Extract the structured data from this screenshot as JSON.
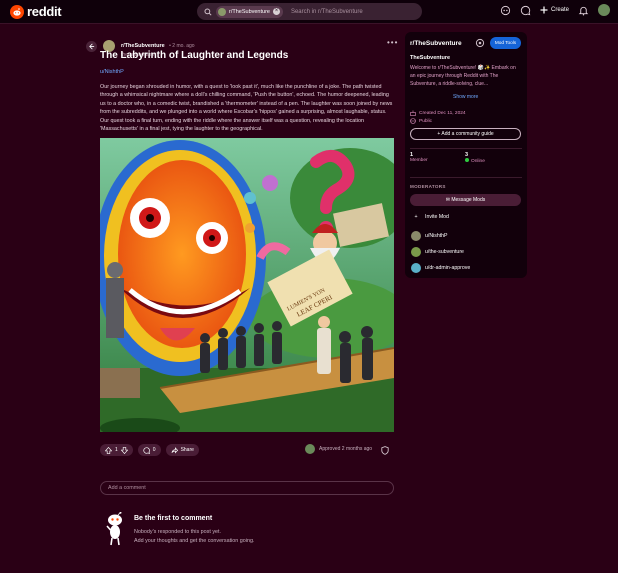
{
  "header": {
    "logo_text": "reddit",
    "search_chip": "r/TheSubventure",
    "search_placeholder": "Search in r/TheSubventure",
    "create_label": "Create"
  },
  "post": {
    "subreddit": "r/TheSubventure",
    "time": "• 2 mo. ago",
    "author": "the-subventure",
    "title": "The Labyrinth of Laughter and Legends",
    "link": "u/NishthP",
    "body": "Our journey began shrouded in humor, with a quest to 'look past it', much like the punchline of a joke. The path twisted through a whimsical nightmare where a doll's chilling command, 'Push the button', echoed. The humor deepened, leading us to a doctor who, in a comedic twist, brandished a 'thermometer' instead of a pen. The laughter was soon joined by news from the subreddits, and we plunged into a world where Escobar's 'hippos' gained a surprising, almost laughable, status. Our quest took a final turn, ending with the riddle where the answer itself was a question, revealing the location 'Massachusetts' in a final jest, tying the laughter to the geographical.",
    "image_sign_text": [
      "LUMIEN'S YON",
      "LEAF CPERI"
    ],
    "votes": "1",
    "comments": "0",
    "share_label": "Share",
    "approved_text": "Approved 2 months ago"
  },
  "comments": {
    "placeholder": "Add a comment",
    "empty_title": "Be the first to comment",
    "empty_line1": "Nobody's responded to this post yet.",
    "empty_line2": "Add your thoughts and get the conversation going."
  },
  "sidebar": {
    "name": "r/TheSubventure",
    "mod_tools_label": "Mod Tools",
    "title": "TheSubventure",
    "description": "Welcome to r/TheSubventure! 🎲✨ Embark on an epic journey through Reddit with The Subventure, a riddle-solving, clue...",
    "show_more": "Show more",
    "created": "Created Dec 11, 2024",
    "visibility": "Public",
    "guide_button": "Add a community guide",
    "members_count": "1",
    "members_label": "Member",
    "online_count": "3",
    "online_label": "Online",
    "moderators_heading": "MODERATORS",
    "message_mods": "Message Mods",
    "invite_mod": "Invite Mod",
    "moderators": [
      {
        "name": "u/NishthP",
        "color": "#8a8a6a"
      },
      {
        "name": "u/the-subventure",
        "color": "#7a9a4a"
      },
      {
        "name": "u/dr-admin-approve",
        "color": "#5ab0c8"
      }
    ]
  },
  "colors": {
    "background": "#2a0015",
    "accent_blue": "#1564d8",
    "brand_orange": "#ff4500"
  }
}
